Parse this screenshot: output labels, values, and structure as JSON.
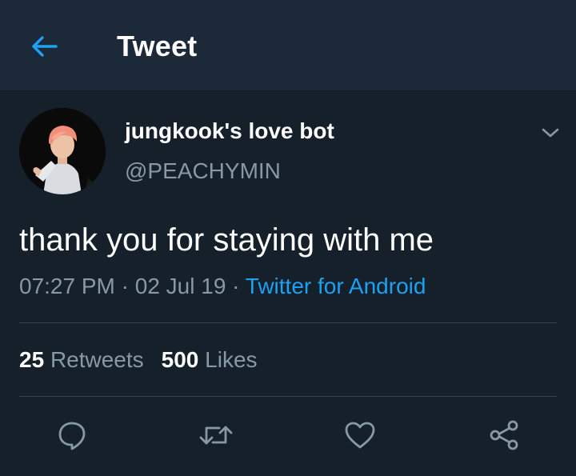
{
  "header": {
    "title": "Tweet",
    "back_icon": "arrow-left-icon"
  },
  "tweet": {
    "author": {
      "display_name": "jungkook's love bot",
      "handle": "@PEACHYMIN",
      "avatar": "profile-photo-peach-hair"
    },
    "text": "thank you for staying with me",
    "time": "07:27 PM",
    "date": "02 Jul 19",
    "separator": "·",
    "source": "Twitter for Android",
    "stats": {
      "retweets_count": "25",
      "retweets_label": "Retweets",
      "likes_count": "500",
      "likes_label": "Likes"
    },
    "actions": [
      {
        "name": "reply",
        "icon": "speech-bubble-icon"
      },
      {
        "name": "retweet",
        "icon": "retweet-arrows-icon"
      },
      {
        "name": "like",
        "icon": "heart-icon"
      },
      {
        "name": "share",
        "icon": "share-nodes-icon"
      }
    ]
  },
  "colors": {
    "background": "#15202b",
    "header_background": "#1c2938",
    "accent": "#1da1f2",
    "secondary_text": "#8899a6",
    "divider": "#38444d"
  }
}
